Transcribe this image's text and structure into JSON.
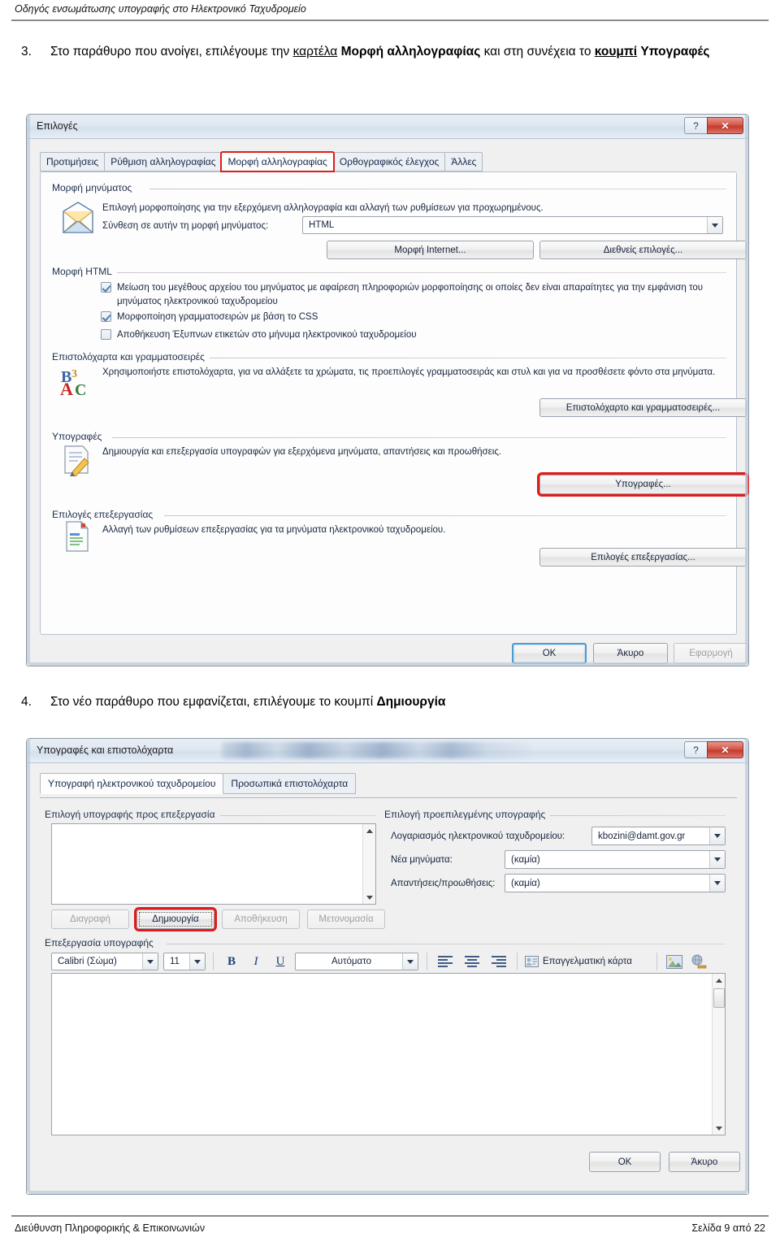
{
  "page": {
    "header": "Οδηγός ενσωμάτωσης υπογραφής στο Ηλεκτρονικό Ταχυδρομείο",
    "footer_left": "Διεύθυνση Πληροφορικής & Επικοινωνιών",
    "footer_right": "Σελίδα 9 από 22"
  },
  "steps": [
    {
      "number": "3.",
      "t1": "Στο παράθυρο που ανοίγει, επιλέγουμε την ",
      "t2": "καρτέλα",
      "t3": " ",
      "t4": "Μορφή αλληλογραφίας",
      "t5": " και στη συνέχεια το ",
      "t6": "κουμπί",
      "t7": " ",
      "t8": "Υπογραφές"
    },
    {
      "number": "4.",
      "t1": "Στο νέο παράθυρο που εμφανίζεται, επιλέγουμε το κουμπί ",
      "t2": "Δημιουργία"
    }
  ],
  "options_dialog": {
    "title": "Επιλογές",
    "help_glyph": "?",
    "close_glyph": "✕",
    "tabs": [
      {
        "label": "Προτιμήσεις",
        "active": false
      },
      {
        "label": "Ρύθμιση αλληλογραφίας",
        "active": false
      },
      {
        "label": "Μορφή αλληλογραφίας",
        "active": true
      },
      {
        "label": "Ορθογραφικός έλεγχος",
        "active": false
      },
      {
        "label": "Άλλες",
        "active": false
      }
    ],
    "message_format": {
      "group_label": "Μορφή μηνύματος",
      "description": "Επιλογή μορφοποίησης για την εξερχόμενη αλληλογραφία και αλλαγή των ρυθμίσεων για προχωρημένους.",
      "compose_label": "Σύνθεση σε αυτήν τη μορφή μηνύματος:",
      "compose_value": "HTML",
      "internet_button": "Μορφή Internet...",
      "international_button": "Διεθνείς επιλογές..."
    },
    "html_format": {
      "group_label": "Μορφή HTML",
      "checkboxes": [
        {
          "label": "Μείωση του μεγέθους αρχείου του μηνύματος με αφαίρεση πληροφοριών μορφοποίησης οι οποίες δεν είναι απαραίτητες για την εμφάνιση του μηνύματος ηλεκτρονικού ταχυδρομείου",
          "checked": true
        },
        {
          "label": "Μορφοποίηση γραμματοσειρών με βάση το CSS",
          "checked": true
        },
        {
          "label": "Αποθήκευση Έξυπνων ετικετών στο μήνυμα ηλεκτρονικού ταχυδρομείου",
          "checked": false
        }
      ]
    },
    "stationery": {
      "group_label": "Επιστολόχαρτα και γραμματοσειρές",
      "description": "Χρησιμοποιήστε επιστολόχαρτα, για να αλλάξετε τα χρώματα, τις προεπιλογές γραμματοσειράς και στυλ και για να προσθέσετε φόντο στα μηνύματα.",
      "button": "Επιστολόχαρτο και γραμματοσειρές..."
    },
    "signatures": {
      "group_label": "Υπογραφές",
      "description": "Δημιουργία και επεξεργασία υπογραφών για εξερχόμενα μηνύματα, απαντήσεις και προωθήσεις.",
      "button": "Υπογραφές..."
    },
    "editor_options": {
      "group_label": "Επιλογές επεξεργασίας",
      "description": "Αλλαγή των ρυθμίσεων επεξεργασίας για τα μηνύματα ηλεκτρονικού ταχυδρομείου.",
      "button": "Επιλογές επεξεργασίας..."
    },
    "footer_buttons": {
      "ok": "OK",
      "cancel": "Άκυρο",
      "apply": "Εφαρμογή"
    }
  },
  "signatures_dialog": {
    "title": "Υπογραφές και επιστολόχαρτα",
    "help_glyph": "?",
    "close_glyph": "✕",
    "tabs": [
      {
        "label": "Υπογραφή ηλεκτρονικού ταχυδρομείου",
        "active": true
      },
      {
        "label": "Προσωπικά επιστολόχαρτα",
        "active": false
      }
    ],
    "select_group_label": "Επιλογή υπογραφής προς επεξεργασία",
    "list_items": [],
    "list_buttons": [
      {
        "label": "Διαγραφή",
        "state": "disabled"
      },
      {
        "label": "Δημιουργία",
        "state": "focused"
      },
      {
        "label": "Αποθήκευση",
        "state": "disabled"
      },
      {
        "label": "Μετονομασία",
        "state": "disabled"
      }
    ],
    "default_group_label": "Επιλογή προεπιλεγμένης υπογραφής",
    "default_fields": [
      {
        "label": "Λογαριασμός ηλεκτρονικού ταχυδρομείου:",
        "value": "kbozini@damt.gov.gr"
      },
      {
        "label": "Νέα μηνύματα:",
        "value": "(καμία)"
      },
      {
        "label": "Απαντήσεις/προωθήσεις:",
        "value": "(καμία)"
      }
    ],
    "edit_group_label": "Επεξεργασία υπογραφής",
    "toolbar": {
      "font_family": "Calibri (Σώμα)",
      "font_size": "11",
      "bold": "B",
      "italic": "I",
      "underline": "U",
      "color": "Αυτόματο",
      "align_left_icon": "align-left-icon",
      "align_center_icon": "align-center-icon",
      "align_right_icon": "align-right-icon",
      "business_card": "Επαγγελματική κάρτα",
      "picture_icon": "picture-icon",
      "hyperlink_icon": "hyperlink-icon"
    },
    "editor_content": "",
    "footer_buttons": {
      "ok": "OK",
      "cancel": "Άκυρο"
    }
  },
  "colors": {
    "highlight_red": "#e11b1b",
    "titlebar_blue": "#dfe8f2",
    "close_red": "#c23b2e",
    "default_button_blue": "#4b9cd3"
  }
}
